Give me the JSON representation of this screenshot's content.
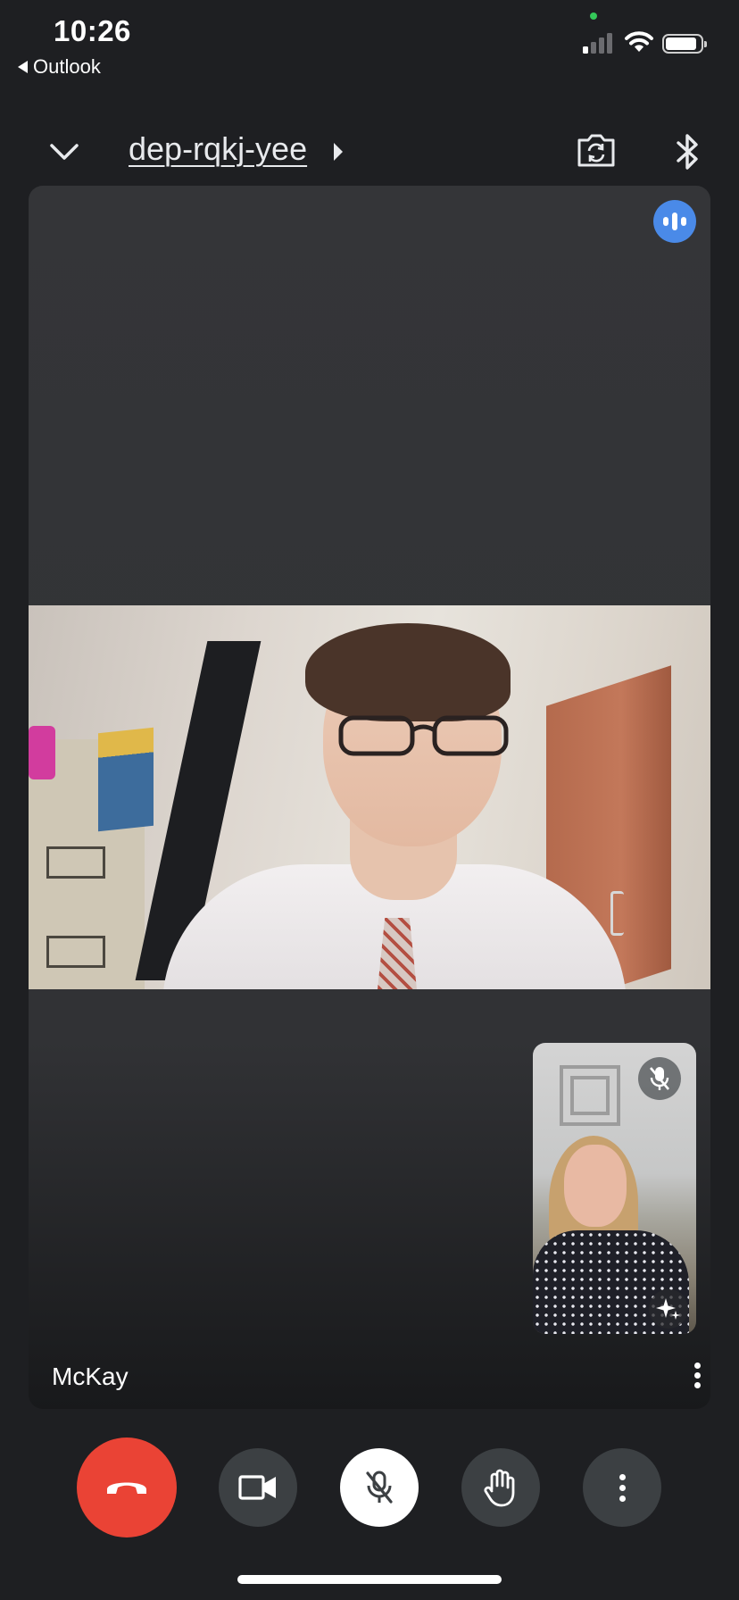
{
  "status_bar": {
    "time": "10:26",
    "back_app": "Outlook",
    "signal_bars_active": 1,
    "signal_bars_total": 4,
    "battery_level": 0.85
  },
  "header": {
    "meeting_code": "dep-rqkj-yee",
    "icons": [
      "chevron-down-icon",
      "switch-camera-icon",
      "bluetooth-icon"
    ]
  },
  "stage": {
    "participant_name": "McKay",
    "speaking_indicator": "active-speaker-icon",
    "self_view": {
      "muted": true,
      "icons": [
        "mic-off-icon",
        "effects-sparkle-icon"
      ]
    }
  },
  "controls": [
    {
      "name": "end-call-button",
      "icon": "phone-hangup-icon",
      "color": "#ea4335"
    },
    {
      "name": "camera-button",
      "icon": "video-camera-icon",
      "color": "#3c4043"
    },
    {
      "name": "mic-button",
      "icon": "mic-off-icon",
      "color": "#ffffff"
    },
    {
      "name": "raise-hand-button",
      "icon": "hand-icon",
      "color": "#3c4043"
    },
    {
      "name": "more-options-button",
      "icon": "more-vert-icon",
      "color": "#3c4043"
    }
  ],
  "colors": {
    "background": "#1e1f22",
    "tile": "#333437",
    "accent_blue": "#4a8ae8",
    "end_call_red": "#ea4335"
  }
}
